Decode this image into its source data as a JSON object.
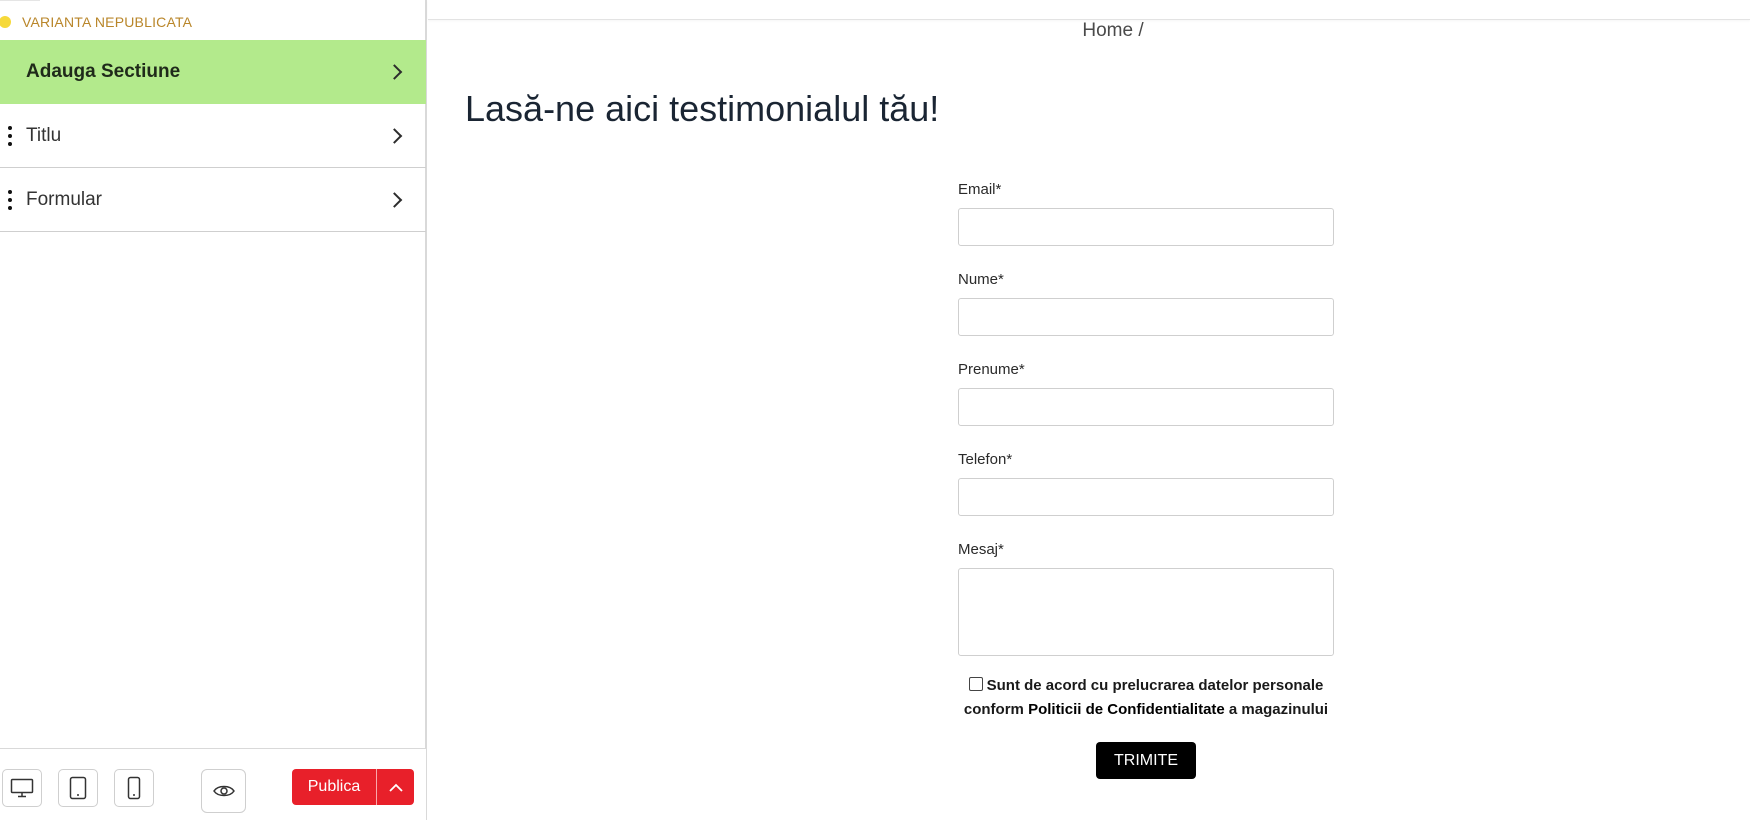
{
  "sidebar": {
    "status": {
      "label": "VARIANTA NEPUBLICATA",
      "dot_color": "#f6d93a"
    },
    "add_section": {
      "label": "Adauga Sectiune",
      "background": "#b3ea8c"
    },
    "sections": [
      {
        "label": "Titlu"
      },
      {
        "label": "Formular"
      }
    ],
    "footer": {
      "device_buttons": [
        {
          "icon": "desktop-icon"
        },
        {
          "icon": "tablet-icon"
        },
        {
          "icon": "mobile-icon"
        }
      ],
      "preview_icon": "eye-icon",
      "publish_label": "Publica",
      "publish_more_icon": "chevron-up-icon",
      "publish_color": "#e8202a"
    }
  },
  "page": {
    "breadcrumb": {
      "home": "Home",
      "separator": "/"
    },
    "title": "Lasă-ne aici testimonialul tău!",
    "form": {
      "fields": [
        {
          "label": "Email",
          "required_mark": "*",
          "value": ""
        },
        {
          "label": "Nume",
          "required_mark": "*",
          "value": ""
        },
        {
          "label": "Prenume",
          "required_mark": "*",
          "value": ""
        },
        {
          "label": "Telefon",
          "required_mark": "*",
          "value": ""
        },
        {
          "label": "Mesaj",
          "required_mark": "*",
          "value": ""
        }
      ],
      "consent": {
        "checked": false,
        "text_before": "Sunt de acord cu prelucrarea datelor personale conform ",
        "link_text": "Politicii de Confidentialitate",
        "text_after": " a magazinului"
      },
      "submit_label": "TRIMITE"
    }
  }
}
